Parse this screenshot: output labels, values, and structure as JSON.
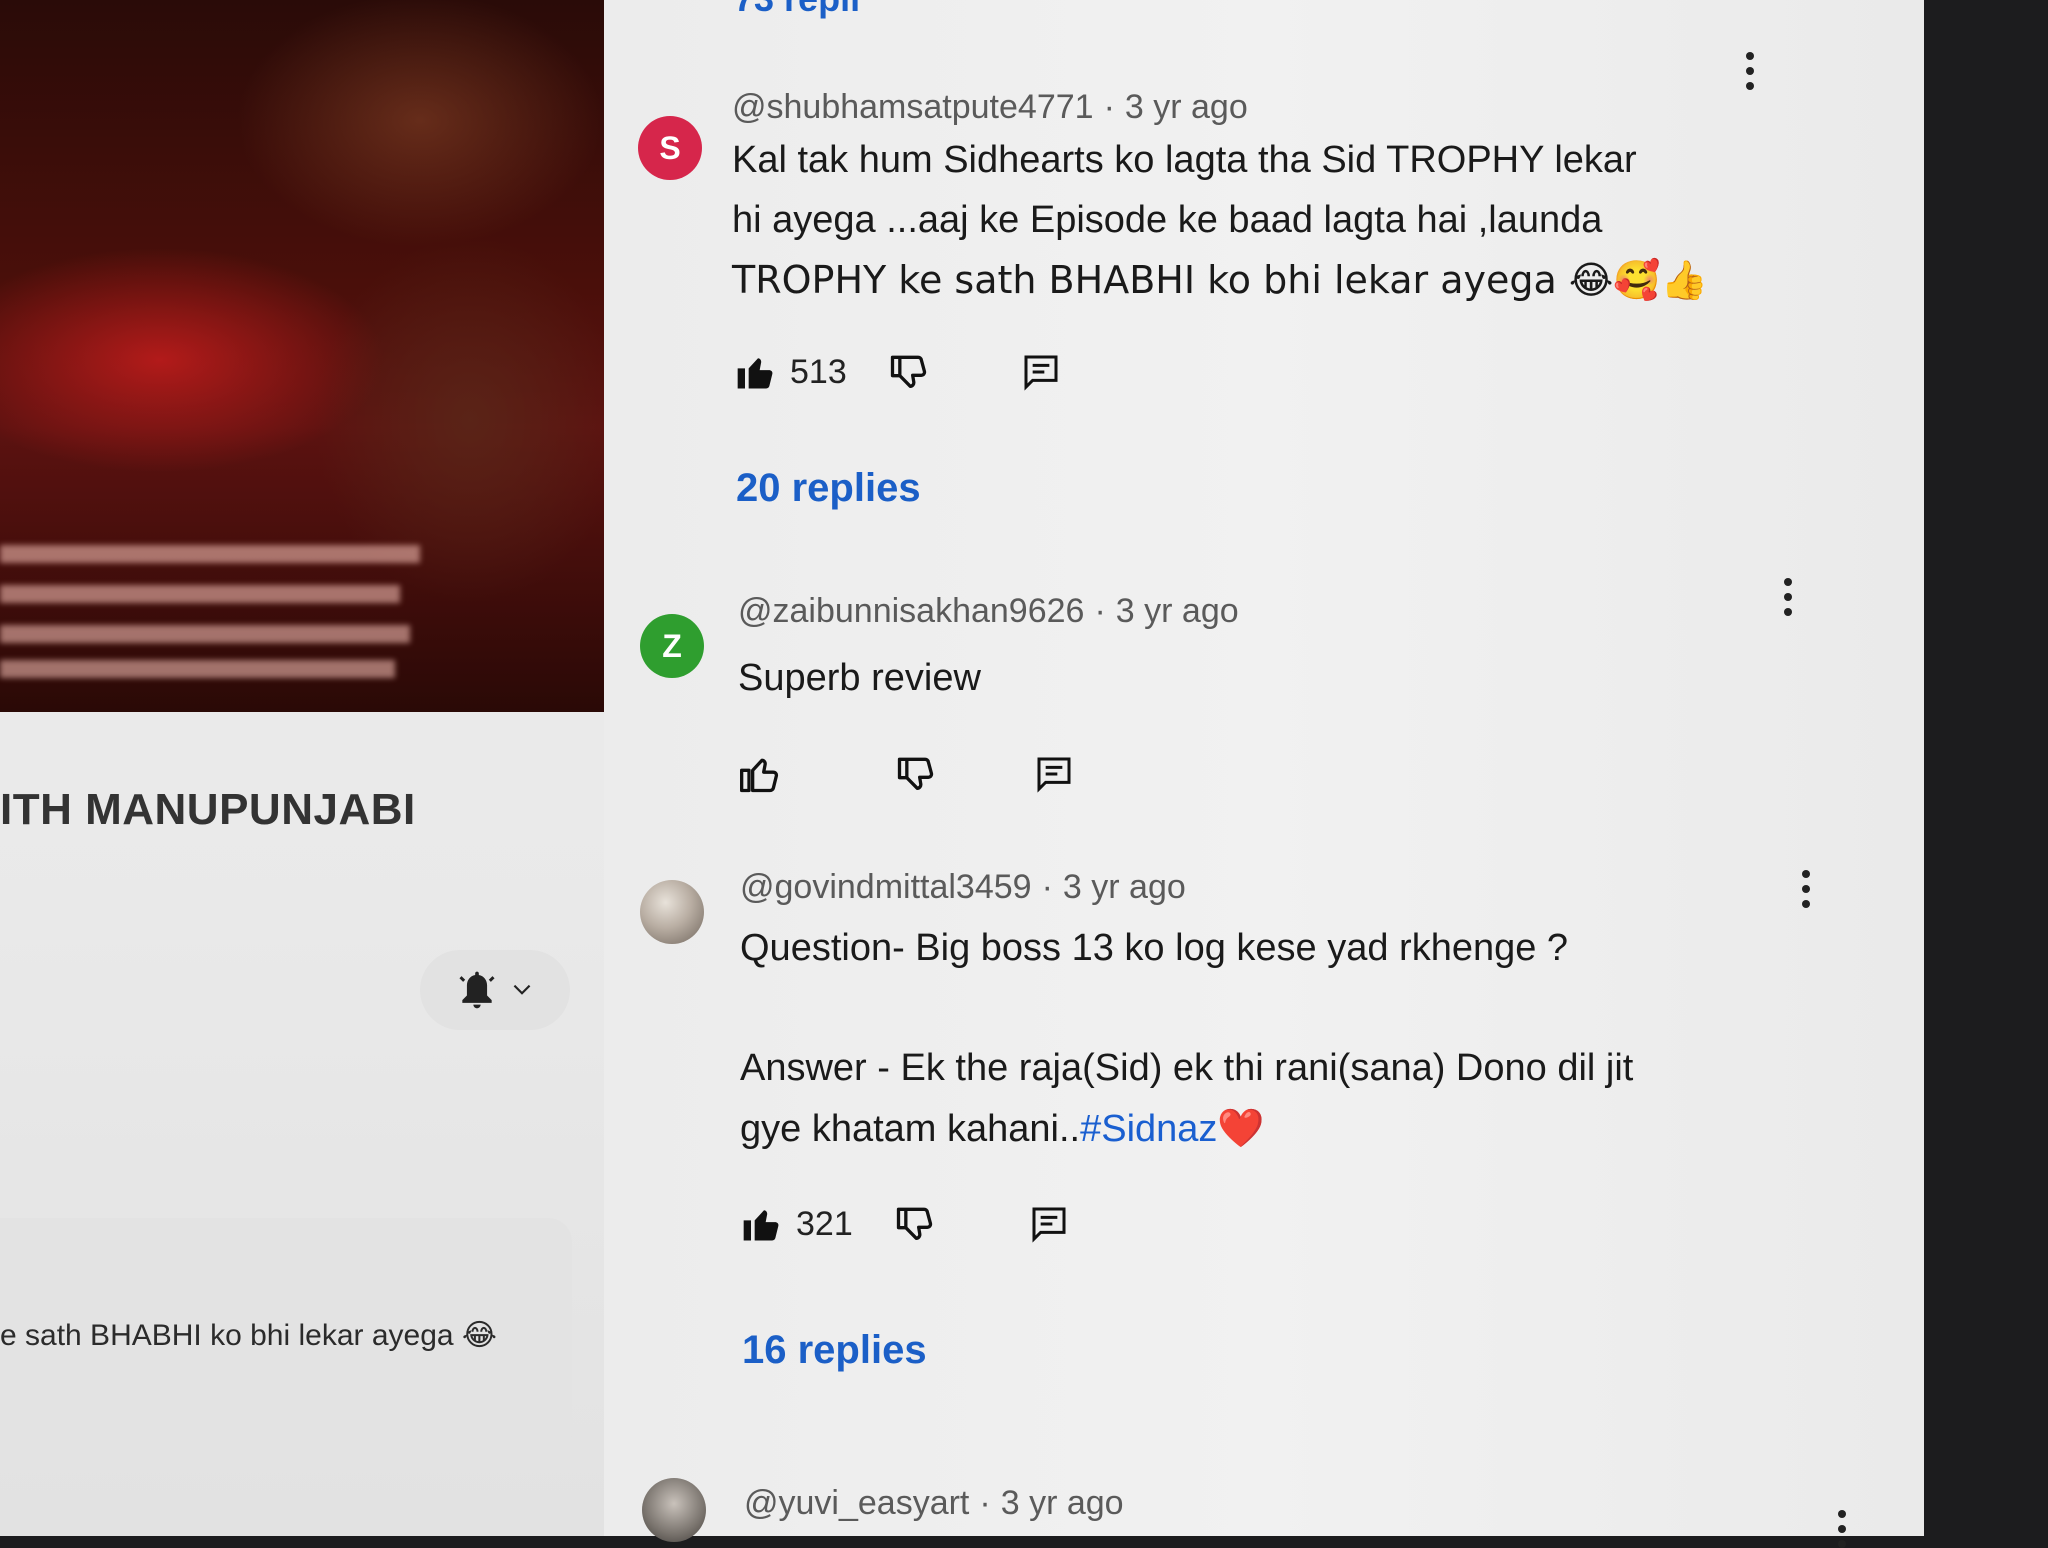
{
  "left": {
    "channel_title": "ITH MANUPUNJABI",
    "pinned_comment_text": "e sath BHABHI ko bhi lekar ayega 😂"
  },
  "top_partial": {
    "replies_label": "73 repli"
  },
  "comments": [
    {
      "avatar_letter": "S",
      "avatar_color": "#d6264b",
      "handle": "@shubhamsatpute4771",
      "time": "3 yr ago",
      "lines": [
        "Kal tak hum Sidhearts ko lagta tha Sid TROPHY lekar",
        "hi ayega ...aaj ke Episode ke baad lagta hai ,launda",
        "TROPHY ke sath BHABHI ko bhi lekar ayega 😂🥰👍"
      ],
      "likes": "513",
      "replies": "20 replies"
    },
    {
      "avatar_letter": "Z",
      "avatar_color": "#2f9e2f",
      "handle": "@zaibunnisakhan9626",
      "time": "3 yr ago",
      "lines": [
        "Superb review"
      ],
      "likes": "",
      "replies": ""
    },
    {
      "avatar_letter": "",
      "avatar_color": "#9a8f86",
      "handle": "@govindmittal3459",
      "time": "3 yr ago",
      "lines": [
        "Question- Big boss 13 ko log kese yad rkhenge ?",
        "",
        "Answer - Ek the raja(Sid) ek thi rani(sana) Dono dil jit",
        "gye khatam kahani.."
      ],
      "hashtag": "#Sidnaz",
      "heart": "❤️",
      "likes": "321",
      "replies": "16 replies"
    },
    {
      "avatar_letter": "",
      "avatar_color": "#6b7076",
      "handle": "@yuvi_easyart",
      "time": "3 yr ago"
    }
  ],
  "colors": {
    "link_blue": "#1b5fc7",
    "hashtag_blue": "#1a5fd0"
  },
  "icons": [
    "like-icon",
    "dislike-icon",
    "reply-icon",
    "kebab-menu-icon",
    "bell-icon",
    "chevron-down-icon"
  ]
}
